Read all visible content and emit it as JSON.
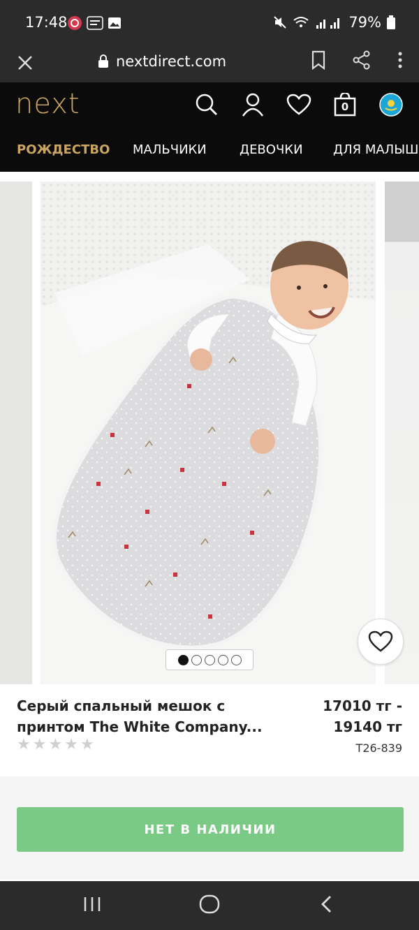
{
  "status": {
    "time": "17:48",
    "battery": "79%"
  },
  "browser": {
    "url": "nextdirect.com"
  },
  "site": {
    "logo": "next",
    "bag_count": "0"
  },
  "nav": {
    "items": [
      "РОЖДЕСТВО",
      "МАЛЬЧИКИ",
      "ДЕВОЧКИ",
      "ДЛЯ МАЛЫШ"
    ]
  },
  "product": {
    "title_line1": "Серый спальный мешок с",
    "title_line2": "принтом The White Company...",
    "price_line1": "17010 тг -",
    "price_line2": "19140 тг",
    "code": "T26-839",
    "rating": 0,
    "image_count": 5,
    "active_image": 1
  },
  "cta": {
    "label": "НЕТ В НАЛИЧИИ"
  },
  "colors": {
    "brand_gold": "#c9a561",
    "cta_green": "#7ac985"
  }
}
